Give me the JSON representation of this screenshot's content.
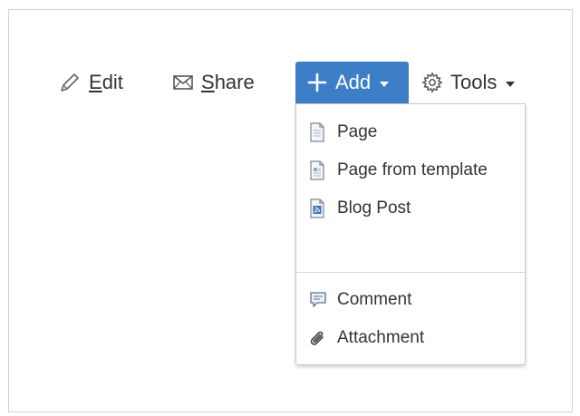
{
  "toolbar": {
    "edit": {
      "label_underlined": "E",
      "label_rest": "dit",
      "icon": "pencil-icon"
    },
    "share": {
      "label_underlined": "S",
      "label_rest": "hare",
      "icon": "envelope-icon"
    },
    "add": {
      "label": "Add",
      "icon": "plus-icon",
      "background": "#3c7fc7"
    },
    "tools": {
      "label": "Tools",
      "icon": "gear-icon"
    }
  },
  "add_menu": {
    "create_items": [
      {
        "label": "Page",
        "icon": "page-icon"
      },
      {
        "label": "Page from template",
        "icon": "template-icon"
      },
      {
        "label": "Blog Post",
        "icon": "blog-post-icon"
      }
    ],
    "attach_items": [
      {
        "label": "Comment",
        "icon": "comment-icon"
      },
      {
        "label": "Attachment",
        "icon": "paperclip-icon"
      }
    ]
  }
}
